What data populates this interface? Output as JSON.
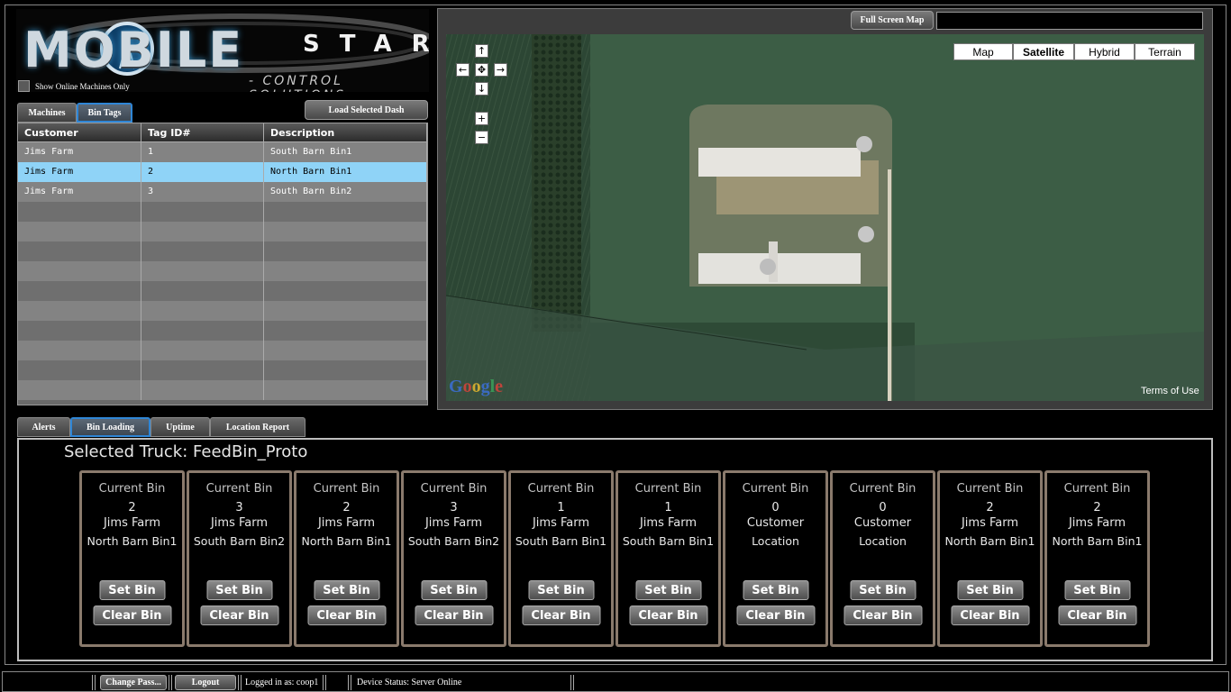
{
  "logo": {
    "brand_main": "MOBILE",
    "brand_accent": "STAR",
    "tagline": "- CONTROL SOLUTIONS"
  },
  "online_filter": {
    "label": "Show Online Machines Only",
    "checked": false
  },
  "list_tabs": [
    {
      "label": "Machines",
      "active": false
    },
    {
      "label": "Bin Tags",
      "active": true
    }
  ],
  "load_dash_button": "Load Selected Dash",
  "bin_table": {
    "columns": [
      "Customer",
      "Tag ID#",
      "Description"
    ],
    "rows": [
      {
        "customer": "Jims Farm",
        "tag": "1",
        "description": "South Barn Bin1",
        "selected": false
      },
      {
        "customer": "Jims Farm",
        "tag": "2",
        "description": "North Barn Bin1",
        "selected": true
      },
      {
        "customer": "Jims Farm",
        "tag": "3",
        "description": "South Barn Bin2",
        "selected": false
      }
    ]
  },
  "map": {
    "full_screen_button": "Full Screen Map",
    "search_value": "",
    "types": [
      {
        "label": "Map",
        "active": false
      },
      {
        "label": "Satellite",
        "active": true
      },
      {
        "label": "Hybrid",
        "active": false
      },
      {
        "label": "Terrain",
        "active": false
      }
    ],
    "nav": {
      "up": "↑",
      "down": "↓",
      "left": "←",
      "right": "→",
      "center": "✥",
      "zoom_in": "+",
      "zoom_out": "−"
    },
    "provider": "Google",
    "terms": "Terms of Use"
  },
  "bottom_tabs": [
    {
      "label": "Alerts",
      "active": false
    },
    {
      "label": "Bin Loading",
      "active": true
    },
    {
      "label": "Uptime",
      "active": false
    },
    {
      "label": "Location Report",
      "active": false
    }
  ],
  "selected_truck": {
    "label": "Selected Truck:",
    "value": "FeedBin_Proto"
  },
  "bins": [
    {
      "title": "Current Bin",
      "number": "2",
      "customer": "Jims Farm",
      "description": "North Barn Bin1",
      "set": "Set Bin",
      "clear": "Clear Bin"
    },
    {
      "title": "Current Bin",
      "number": "3",
      "customer": "Jims Farm",
      "description": "South Barn Bin2",
      "set": "Set Bin",
      "clear": "Clear Bin"
    },
    {
      "title": "Current Bin",
      "number": "2",
      "customer": "Jims Farm",
      "description": "North Barn Bin1",
      "set": "Set Bin",
      "clear": "Clear Bin"
    },
    {
      "title": "Current Bin",
      "number": "3",
      "customer": "Jims Farm",
      "description": "South Barn Bin2",
      "set": "Set Bin",
      "clear": "Clear Bin"
    },
    {
      "title": "Current Bin",
      "number": "1",
      "customer": "Jims Farm",
      "description": "South Barn Bin1",
      "set": "Set Bin",
      "clear": "Clear Bin"
    },
    {
      "title": "Current Bin",
      "number": "1",
      "customer": "Jims Farm",
      "description": "South Barn Bin1",
      "set": "Set Bin",
      "clear": "Clear Bin"
    },
    {
      "title": "Current Bin",
      "number": "0",
      "customer": "Customer",
      "description": "Location",
      "set": "Set Bin",
      "clear": "Clear Bin"
    },
    {
      "title": "Current Bin",
      "number": "0",
      "customer": "Customer",
      "description": "Location",
      "set": "Set Bin",
      "clear": "Clear Bin"
    },
    {
      "title": "Current Bin",
      "number": "2",
      "customer": "Jims Farm",
      "description": "North Barn Bin1",
      "set": "Set Bin",
      "clear": "Clear Bin"
    },
    {
      "title": "Current Bin",
      "number": "2",
      "customer": "Jims Farm",
      "description": "North Barn Bin1",
      "set": "Set Bin",
      "clear": "Clear Bin"
    }
  ],
  "status_bar": {
    "change_pass": "Change Pass...",
    "logout": "Logout",
    "logged_in": "Logged in as: coop1",
    "device_status": "Device Status: Server Online"
  },
  "colors": {
    "selected_row": "#8fd3f7",
    "active_tab_border": "#2f86d6",
    "card_border": "#8a7a6c"
  }
}
